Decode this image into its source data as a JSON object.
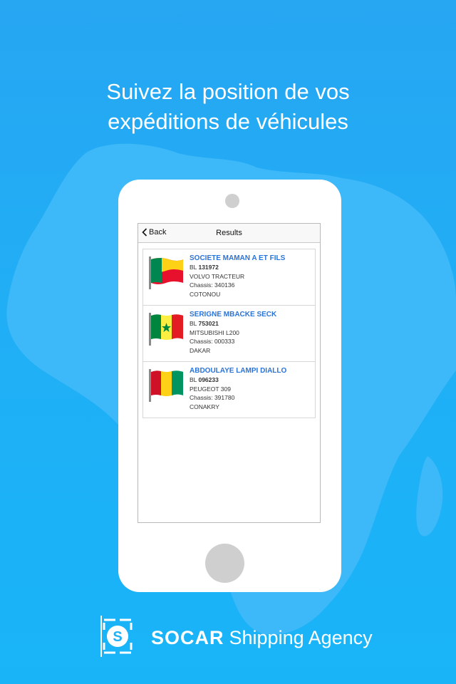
{
  "headline": {
    "line1": "Suivez la position de vos",
    "line2": "expéditions de véhicules"
  },
  "colors": {
    "background": "#1fb0f6",
    "map": "#3db8f8",
    "link_blue": "#2a73d8"
  },
  "screen": {
    "back_label": "Back",
    "title": "Results"
  },
  "results": [
    {
      "name": "SOCIETE MAMAN A ET FILS",
      "bl_prefix": "BL",
      "bl_number": "131972",
      "vehicle": "VOLVO TRACTEUR",
      "chassis": "Chassis: 340136",
      "destination": "COTONOU",
      "flag_icon": "benin-flag-icon"
    },
    {
      "name": "SERIGNE MBACKE SECK",
      "bl_prefix": "BL",
      "bl_number": "753021",
      "vehicle": "MITSUBISHI L200",
      "chassis": "Chassis: 000333",
      "destination": "DAKAR",
      "flag_icon": "senegal-flag-icon"
    },
    {
      "name": "ABDOULAYE LAMPI DIALLO",
      "bl_prefix": "BL",
      "bl_number": "096233",
      "vehicle": "PEUGEOT 309",
      "chassis": "Chassis: 391780",
      "destination": "CONAKRY",
      "flag_icon": "guinea-flag-icon"
    }
  ],
  "brand": {
    "name_strong": "SOCAR",
    "name_rest": "Shipping Agency",
    "logo_letter": "S"
  }
}
